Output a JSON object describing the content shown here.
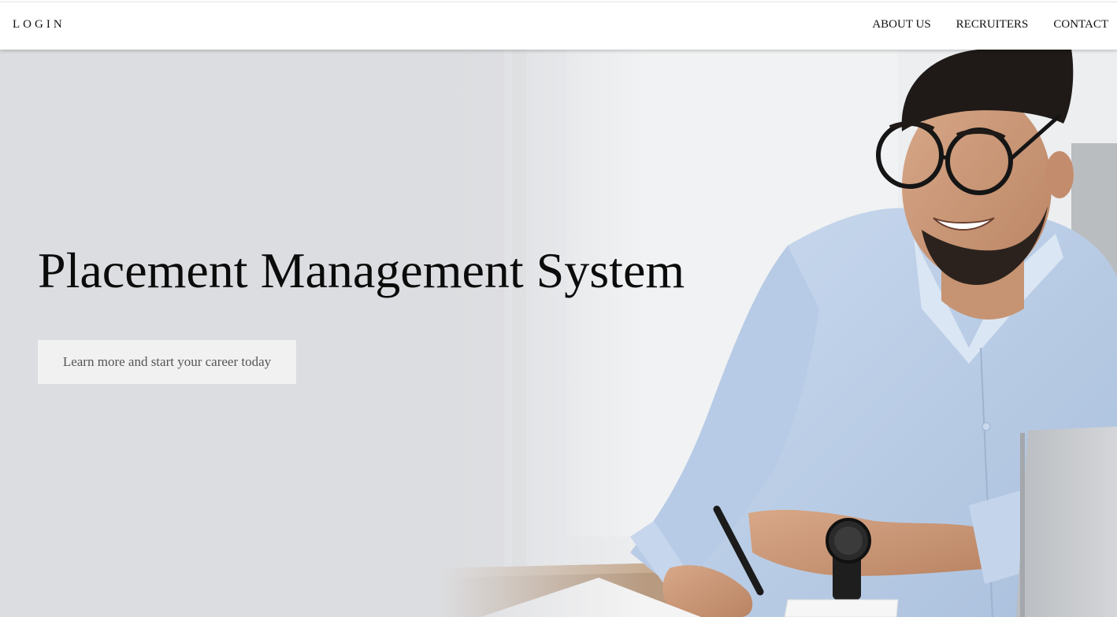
{
  "nav": {
    "login": "LOGIN",
    "links": [
      "ABOUT US",
      "RECRUITERS",
      "CONTACT"
    ]
  },
  "hero": {
    "title": "Placement Management System",
    "cta_label": "Learn more and start your career today",
    "image": "hero-man-with-glasses-writing-at-desk"
  },
  "colors": {
    "background": "#dcdde0",
    "shirt": "#b9cde6",
    "text": "#0b0b0b",
    "cta_bg": "#f0f1f0"
  }
}
